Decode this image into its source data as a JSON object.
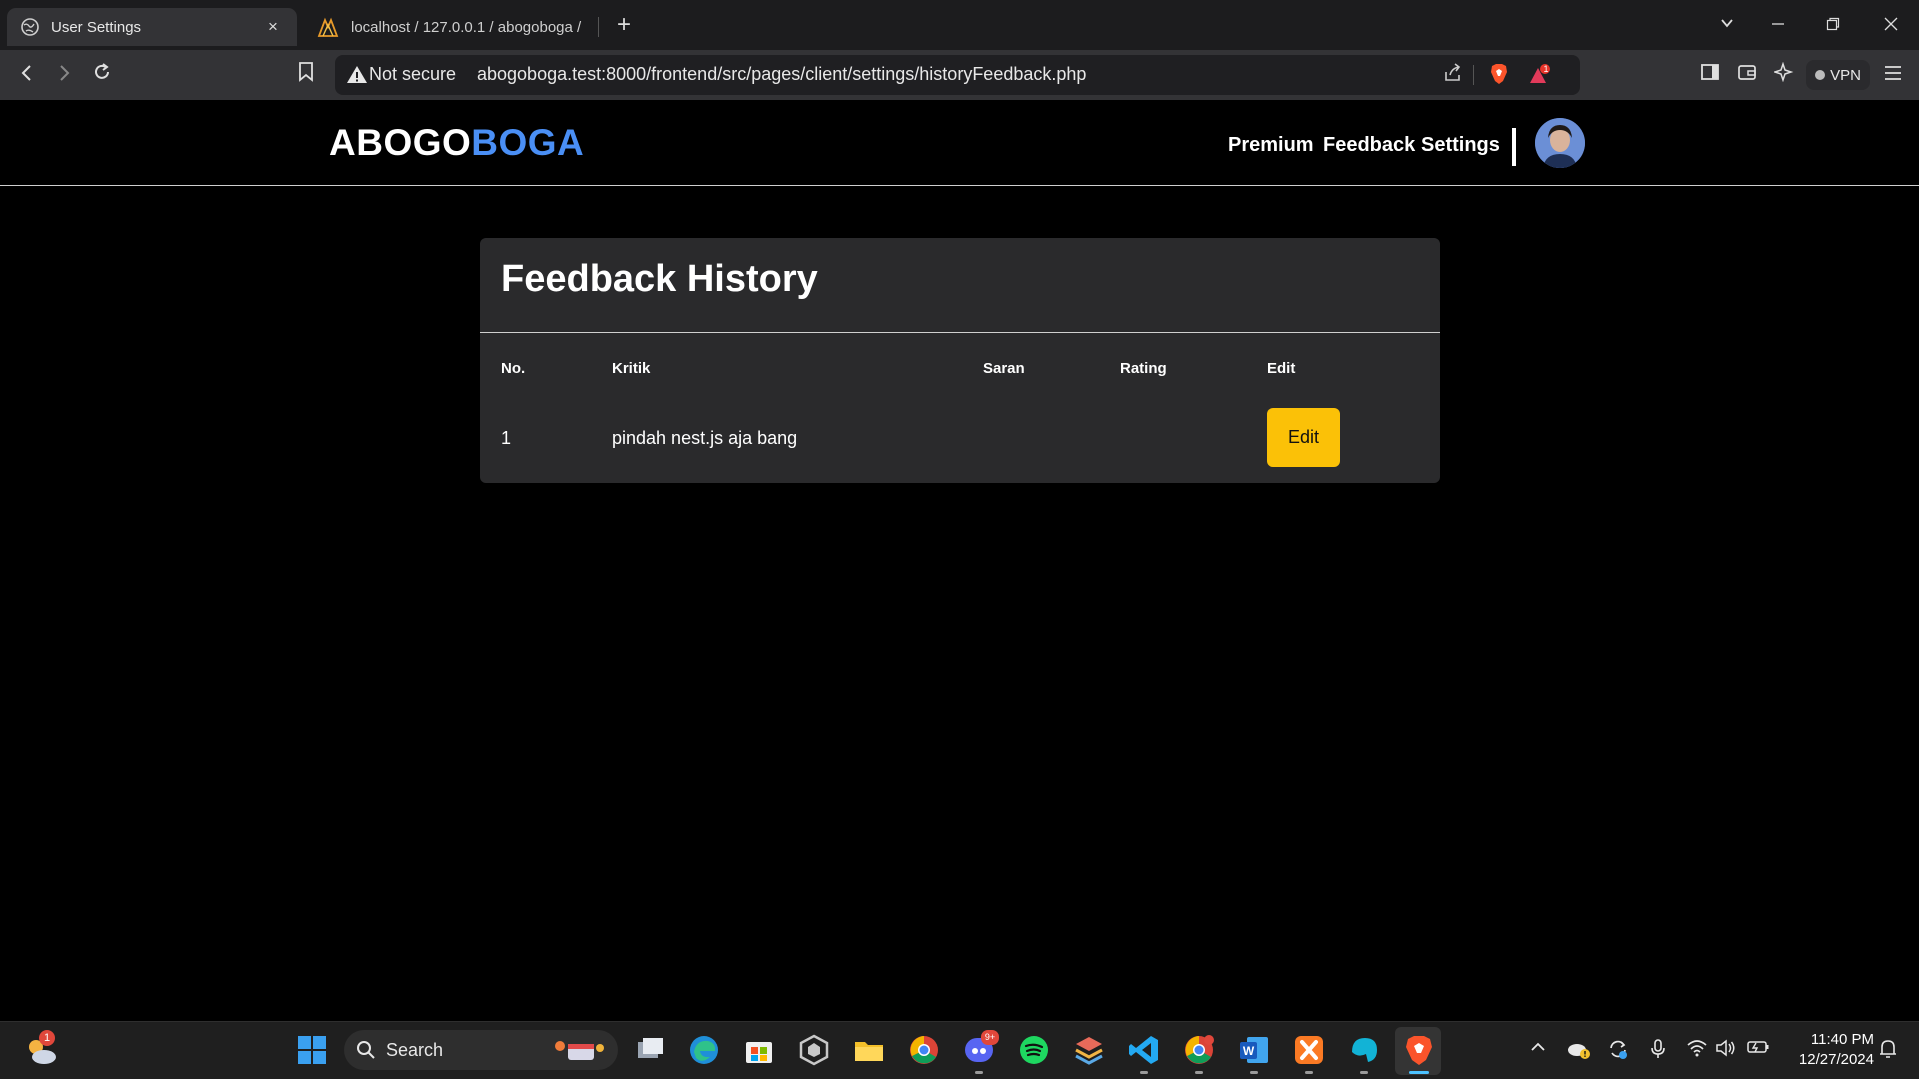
{
  "browser": {
    "active_tab": {
      "title": "User Settings",
      "close": "×"
    },
    "inactive_tab": {
      "title": "localhost / 127.0.0.1 / abogoboga /"
    },
    "new_tab": "+",
    "security_label": "Not secure",
    "url": "abogoboga.test:8000/frontend/src/pages/client/settings/historyFeedback.php",
    "vpn_label": "VPN",
    "notification_badge": "1"
  },
  "site": {
    "logo_part1": "ABOGO",
    "logo_part2": "BOGA",
    "logo_colors": {
      "part1": "#ffffff",
      "part2": "#4a8ff5"
    },
    "nav": [
      {
        "label": "Premium"
      },
      {
        "label": "Feedback"
      },
      {
        "label": "Settings"
      }
    ]
  },
  "feedback_history": {
    "title": "Feedback History",
    "columns": [
      "No.",
      "Kritik",
      "Saran",
      "Rating",
      "Edit"
    ],
    "rows": [
      {
        "no": "1",
        "kritik": "pindah nest.js aja bang",
        "saran": "",
        "rating": "",
        "edit_label": "Edit"
      }
    ],
    "edit_button_color": "#fbc107"
  },
  "taskbar": {
    "search_placeholder": "Search",
    "weather_badge": "1",
    "discord_badge": "9+",
    "time": "11:40 PM",
    "date": "12/27/2024"
  }
}
